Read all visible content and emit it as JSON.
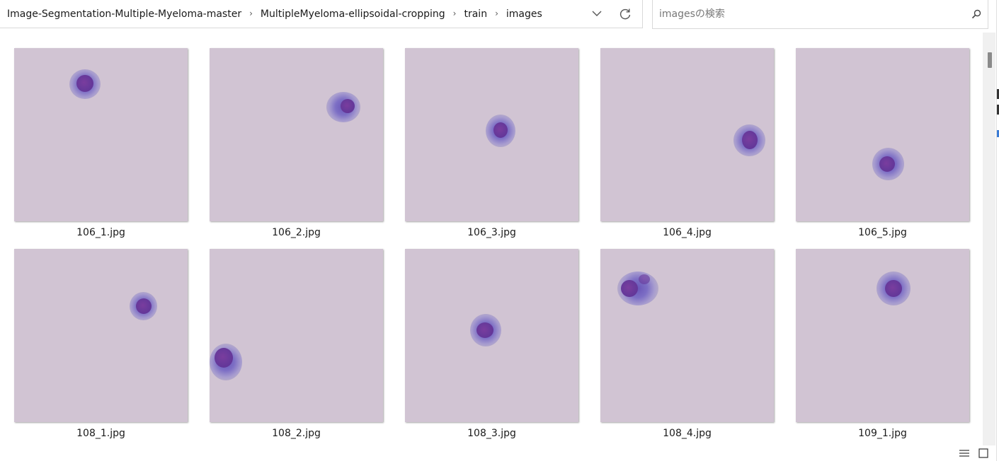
{
  "address_bar": {
    "breadcrumb": [
      "Image-Segmentation-Multiple-Myeloma-master",
      "MultipleMyeloma-ellipsoidal-cropping",
      "train",
      "images"
    ],
    "dropdown_icon": "chevron-down-icon",
    "refresh_icon": "refresh-icon"
  },
  "search": {
    "placeholder": "imagesの検索",
    "value": "",
    "icon": "search-icon"
  },
  "files": [
    {
      "name": "106_1.jpg"
    },
    {
      "name": "106_2.jpg"
    },
    {
      "name": "106_3.jpg"
    },
    {
      "name": "106_4.jpg"
    },
    {
      "name": "106_5.jpg"
    },
    {
      "name": "108_1.jpg"
    },
    {
      "name": "108_2.jpg"
    },
    {
      "name": "108_3.jpg"
    },
    {
      "name": "108_4.jpg"
    },
    {
      "name": "109_1.jpg"
    }
  ],
  "statusbar": {
    "details_view_icon": "details-view-icon",
    "large_icons_view_icon": "large-icons-view-icon"
  },
  "colors": {
    "thumbnail_background": "#d1c4d3",
    "cell_cytoplasm": "#7d6fc5",
    "cell_nucleus": "#6a3a9b"
  }
}
